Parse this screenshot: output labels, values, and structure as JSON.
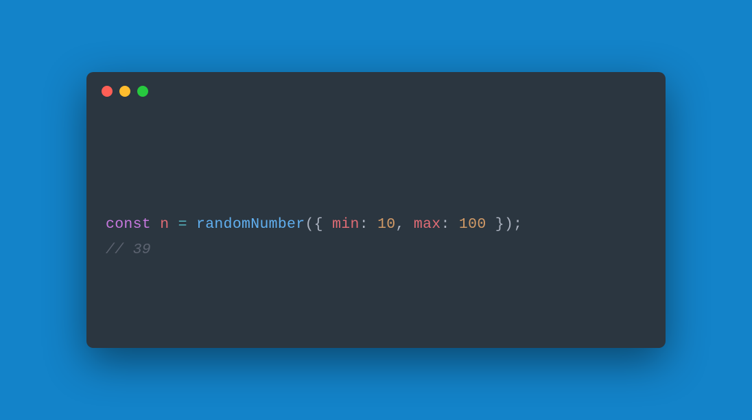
{
  "window": {
    "traffic_lights": {
      "close": "#ff5f56",
      "minimize": "#ffbd2e",
      "zoom": "#27c93f"
    }
  },
  "code": {
    "line1": {
      "keyword": "const",
      "identifier": "n",
      "operator": "=",
      "function": "randomNumber",
      "open_paren": "(",
      "open_brace": "{",
      "prop1": "min",
      "colon1": ":",
      "val1": "10",
      "comma": ",",
      "prop2": "max",
      "colon2": ":",
      "val2": "100",
      "close_brace": "}",
      "close_paren": ")",
      "semicolon": ";"
    },
    "line2": {
      "comment": "// 39"
    }
  }
}
